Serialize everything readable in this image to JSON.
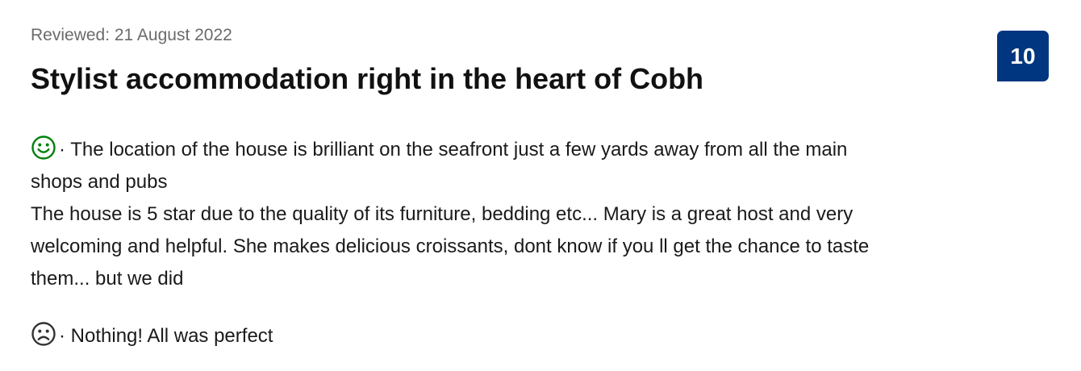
{
  "review": {
    "date": "Reviewed: 21 August 2022",
    "title": "Stylist accommodation right in the heart of Cobh",
    "score": "10",
    "positive": {
      "icon": "smile-icon",
      "lines": [
        "· The location of the house is brilliant on the seafront just a few yards away from all the main",
        "shops and pubs",
        "The house is 5 star due to the quality of its furniture, bedding etc... Mary is a great host and very",
        "welcoming and helpful. She makes delicious croissants, dont know if you ll get the chance to taste",
        "them... but we did"
      ]
    },
    "negative": {
      "icon": "frown-icon",
      "lines": [
        "· Nothing! All was perfect"
      ]
    }
  },
  "colors": {
    "score_badge": "#003580",
    "positive_icon": "#008009",
    "negative_icon": "#333333",
    "meta_text": "#6b6b6b"
  }
}
